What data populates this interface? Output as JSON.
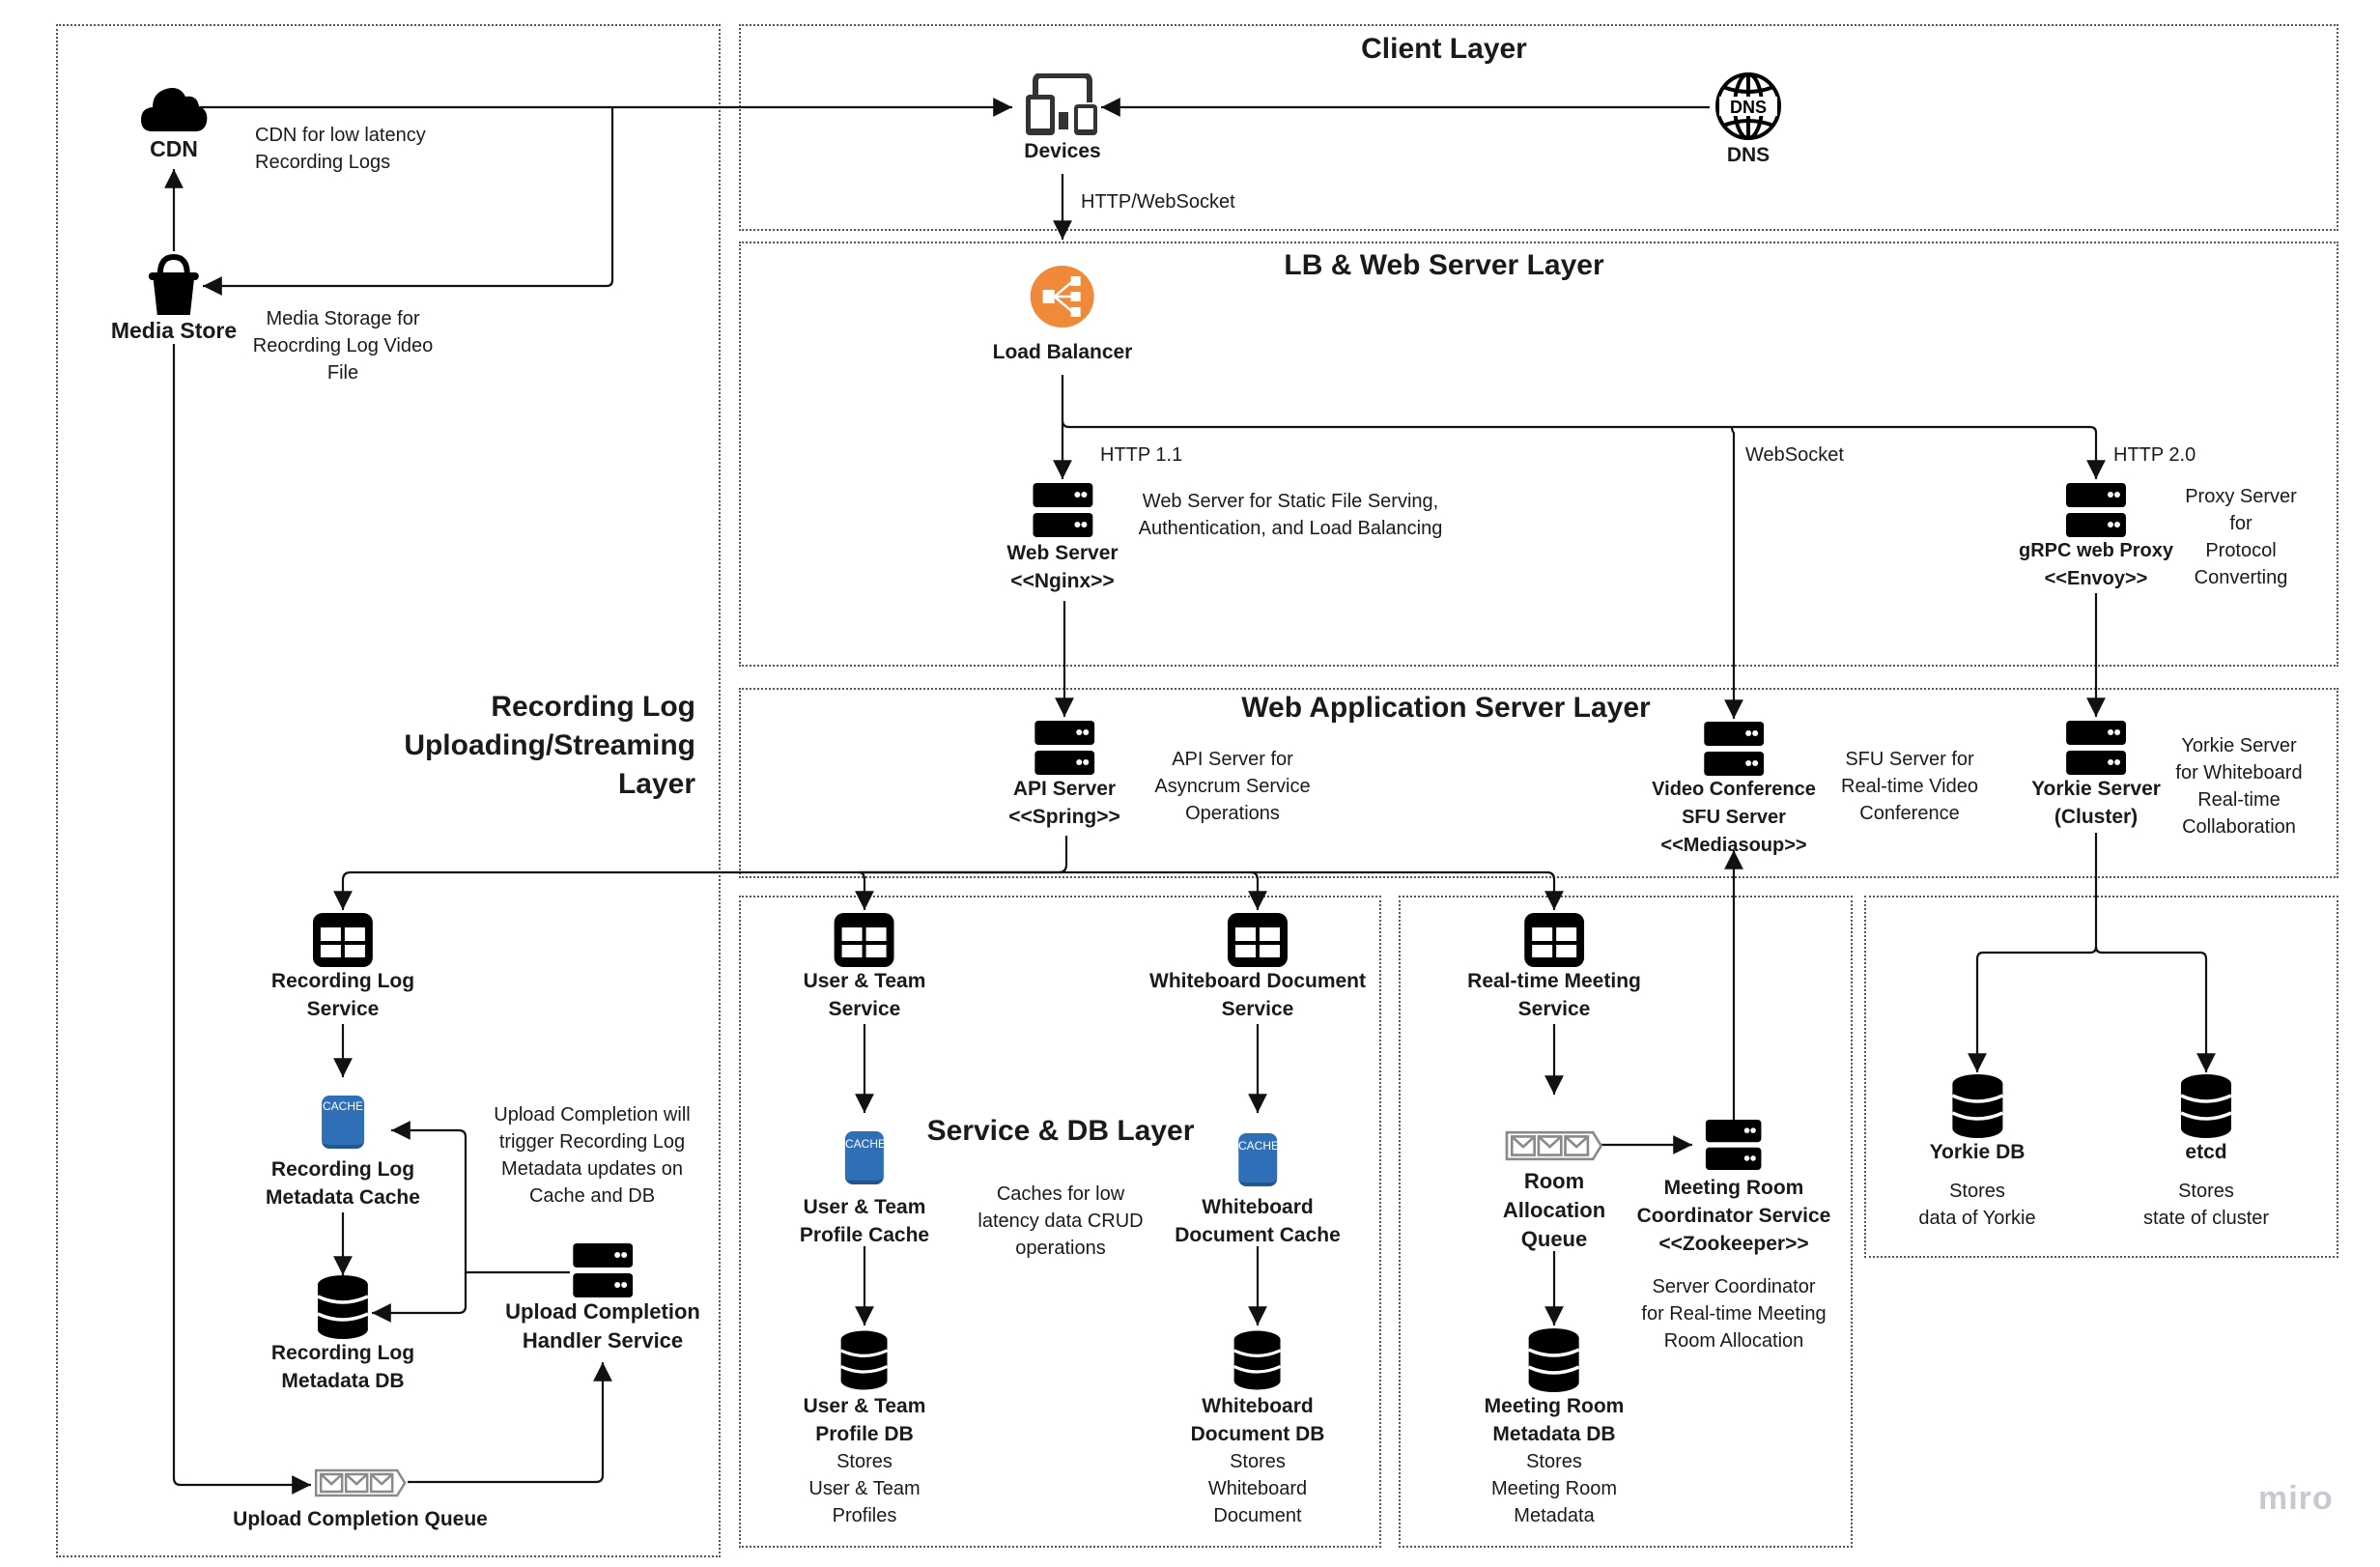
{
  "layers": {
    "client": "Client Layer",
    "lb_web": "LB & Web Server Layer",
    "web_app": "Web Application Server Layer",
    "service_db": "Service & DB Layer",
    "recording": "Recording Log\nUploading/Streaming\nLayer"
  },
  "nodes": {
    "cdn": {
      "label": "CDN",
      "icon": "cloud-icon"
    },
    "media_store": {
      "label": "Media Store",
      "icon": "bucket-icon"
    },
    "devices": {
      "label": "Devices",
      "icon": "devices-icon"
    },
    "dns": {
      "label": "DNS",
      "icon": "dns-globe-icon"
    },
    "load_balancer": {
      "label": "Load Balancer",
      "icon": "load-balancer-icon",
      "color": "#f08a3a"
    },
    "web_server": {
      "label": "Web Server\n<<Nginx>>",
      "icon": "server-icon"
    },
    "grpc_proxy": {
      "label": "gRPC web Proxy\n<<Envoy>>",
      "icon": "server-icon"
    },
    "api_server": {
      "label": "API Server\n<<Spring>>",
      "icon": "server-icon"
    },
    "sfu_server": {
      "label": "Video Conference\nSFU Server\n<<Mediasoup>>",
      "icon": "server-icon"
    },
    "yorkie_server": {
      "label": "Yorkie Server\n(Cluster)",
      "icon": "server-icon"
    },
    "recording_service": {
      "label": "Recording Log\nService",
      "icon": "service-grid-icon"
    },
    "recording_cache": {
      "label": "Recording Log\nMetadata Cache",
      "icon": "cache-icon"
    },
    "recording_db": {
      "label": "Recording Log\nMetadata DB",
      "icon": "database-icon"
    },
    "upload_handler": {
      "label": "Upload Completion\nHandler Service",
      "icon": "server-icon"
    },
    "upload_queue": {
      "label": "Upload Completion Queue",
      "icon": "queue-icon"
    },
    "user_service": {
      "label": "User & Team\nService",
      "icon": "service-grid-icon"
    },
    "user_cache": {
      "label": "User & Team\nProfile Cache",
      "icon": "cache-icon"
    },
    "user_db": {
      "label": "User & Team\nProfile DB",
      "desc": "Stores\nUser & Team\nProfiles",
      "icon": "database-icon"
    },
    "wb_service": {
      "label": "Whiteboard Document\nService",
      "icon": "service-grid-icon"
    },
    "wb_cache": {
      "label": "Whiteboard\nDocument Cache",
      "icon": "cache-icon"
    },
    "wb_db": {
      "label": "Whiteboard\nDocument DB",
      "desc": "Stores\nWhiteboard\nDocument",
      "icon": "database-icon"
    },
    "meeting_service": {
      "label": "Real-time Meeting\nService",
      "icon": "service-grid-icon"
    },
    "room_queue": {
      "label": "Room\nAllocation\nQueue",
      "icon": "queue-icon"
    },
    "coordinator": {
      "label": "Meeting Room\nCoordinator Service\n<<Zookeeper>>",
      "icon": "server-icon"
    },
    "meeting_db": {
      "label": "Meeting Room\nMetadata DB",
      "desc": "Stores\nMeeting Room\nMetadata",
      "icon": "database-icon"
    },
    "yorkie_db": {
      "label": "Yorkie DB",
      "desc": "Stores\ndata of Yorkie",
      "icon": "database-icon"
    },
    "etcd": {
      "label": "etcd",
      "desc": "Stores\nstate of cluster",
      "icon": "database-icon"
    }
  },
  "notes": {
    "cdn": "CDN for low latency\nRecording Logs",
    "media_store": "Media Storage for\nReocrding Log Video\nFile",
    "http_ws": "HTTP/WebSocket",
    "http11": "HTTP 1.1",
    "websocket": "WebSocket",
    "http20": "HTTP 2.0",
    "web_server": "Web Server for Static File Serving,\nAuthentication, and Load Balancing",
    "proxy": "Proxy Server for\nProtocol Converting",
    "api": "API Server for\nAsyncrum Service\nOperations",
    "sfu": "SFU Server for\nReal-time Video\nConference",
    "yorkie": "Yorkie Server\nfor Whiteboard\nReal-time\nCollaboration",
    "upload": "Upload Completion will\ntrigger Recording Log\nMetadata updates on\nCache and DB",
    "caches": "Caches for low\nlatency data CRUD\noperations",
    "coordinator": "Server Coordinator\nfor Real-time Meeting\nRoom Allocation"
  },
  "cache_text": "CACHE",
  "dns_text": "DNS",
  "colors": {
    "cache_blue": "#2f6fb8",
    "lb_orange": "#f08a3a",
    "queue_gray": "#8a8a8a"
  },
  "watermark": "miro"
}
